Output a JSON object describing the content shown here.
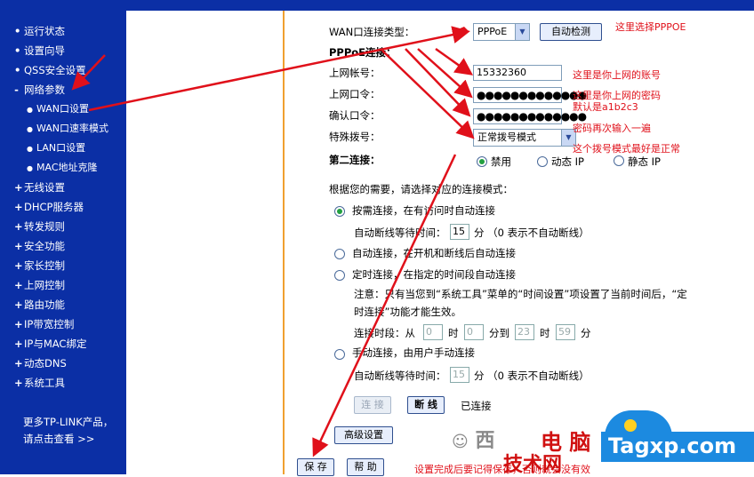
{
  "sidebar": {
    "items": [
      {
        "label": "运行状态",
        "sub": false
      },
      {
        "label": "设置向导",
        "sub": false
      },
      {
        "label": "QSS安全设置",
        "sub": false
      },
      {
        "label": "网络参数",
        "sub": false
      },
      {
        "label": "WAN口设置",
        "sub": true
      },
      {
        "label": "WAN口速率模式",
        "sub": true
      },
      {
        "label": "LAN口设置",
        "sub": true
      },
      {
        "label": "MAC地址克隆",
        "sub": true
      },
      {
        "label": "无线设置",
        "sub": false
      },
      {
        "label": "DHCP服务器",
        "sub": false
      },
      {
        "label": "转发规则",
        "sub": false
      },
      {
        "label": "安全功能",
        "sub": false
      },
      {
        "label": "家长控制",
        "sub": false
      },
      {
        "label": "上网控制",
        "sub": false
      },
      {
        "label": "路由功能",
        "sub": false
      },
      {
        "label": "IP带宽控制",
        "sub": false
      },
      {
        "label": "IP与MAC绑定",
        "sub": false
      },
      {
        "label": "动态DNS",
        "sub": false
      },
      {
        "label": "系统工具",
        "sub": false
      }
    ],
    "bullets": {
      "collapsed": "+",
      "expanded": "-",
      "sub": "●"
    },
    "promo_line1": "更多TP-LINK产品，",
    "promo_line2": "请点击查看 >>"
  },
  "form": {
    "wan_type_label": "WAN口连接类型：",
    "wan_type_value": "PPPoE",
    "detect_button": "自动检测",
    "pppoe_heading": "PPPoE连接：",
    "account_label": "上网帐号：",
    "account_value": "15332360",
    "password_label": "上网口令：",
    "password_value": "●●●●●●●●●●●●●",
    "confirm_label": "确认口令：",
    "confirm_value": "●●●●●●●●●●●●●",
    "dial_label": "特殊拨号：",
    "dial_value": "正常拨号模式",
    "second_label": "第二连接：",
    "second_opt1": "禁用",
    "second_opt2": "动态 IP",
    "second_opt3": "静态 IP",
    "mode_intro": "根据您的需要，请选择对应的连接模式：",
    "mode1": "按需连接，在有访问时自动连接",
    "idle1_prefix": "自动断线等待时间：",
    "idle1_value": "15",
    "idle1_suffix": "分 （0 表示不自动断线）",
    "mode2": "自动连接，在开机和断线后自动连接",
    "mode3": "定时连接，在指定的时间段自动连接",
    "note_line1": "注意：只有当您到“系统工具”菜单的“时间设置”项设置了当前时间后，“定",
    "note_line2": "时连接”功能才能生效。",
    "period_prefix": "连接时段：从",
    "period_h1": "0",
    "period_t1": "时",
    "period_m1": "0",
    "period_t2": "分到",
    "period_h2": "23",
    "period_t3": "时",
    "period_m2": "59",
    "period_t4": "分",
    "mode4": "手动连接，由用户手动连接",
    "idle2_prefix": "自动断线等待时间：",
    "idle2_value": "15",
    "idle2_suffix": "分 （0 表示不自动断线）",
    "connect_button": "连 接",
    "disconnect_button": "断 线",
    "status_text": "已连接",
    "advanced_button": "高级设置",
    "save_button": "保 存",
    "help_button": "帮 助"
  },
  "annotations": {
    "a1": "这里选择PPPOE",
    "a2": "这里是你上网的账号",
    "a3": "这里是你上网的密码",
    "a4": "默认是a1b2c3",
    "a5": "密码再次输入一遍",
    "a6": "这个拨号模式最好是正常",
    "a7": "设置完成后要记得保存，否则就会没有效",
    "color": "#e0101a"
  },
  "watermark": {
    "cn1": "电 脑",
    "cn2": "技术网",
    "site": "Tagxp.com",
    "wechat": "西"
  },
  "colors": {
    "sidebar": "#0b2fa5",
    "divider": "#f0a030",
    "accent_red": "#e0101a"
  }
}
